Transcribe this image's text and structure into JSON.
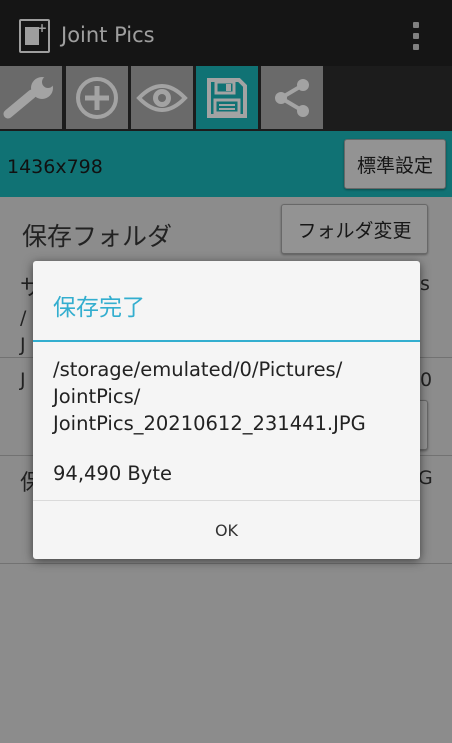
{
  "app": {
    "title": "Joint Pics",
    "icon": "app-image-plus-icon"
  },
  "tabs": [
    {
      "icon": "wrench-icon",
      "active": false
    },
    {
      "icon": "plus-circle-icon",
      "active": false
    },
    {
      "icon": "eye-icon",
      "active": false
    },
    {
      "icon": "save-disk-icon",
      "active": true
    },
    {
      "icon": "share-icon",
      "active": false
    }
  ],
  "info": {
    "resolution": "1436x798",
    "default_button": "標準設定"
  },
  "content": {
    "save_folder_label": "保存フォルダ",
    "change_folder_button": "フォルダ変更",
    "frag_s": "サ",
    "frag_slash": "/",
    "frag_j1": "J",
    "frag_j2": "J",
    "frag_ho": "保",
    "frag_s_right": "s",
    "frag_0": "0",
    "frag_g": "G"
  },
  "dialog": {
    "title": "保存完了",
    "path_line1": "/storage/emulated/0/Pictures/",
    "path_line2": "JointPics/",
    "path_line3": "JointPics_20210612_231441.JPG",
    "size": "94,490 Byte",
    "ok_label": "OK"
  },
  "colors": {
    "accent": "#19a9ab",
    "dialog_title": "#33aecf",
    "actionbar": "#1f1f1f"
  }
}
